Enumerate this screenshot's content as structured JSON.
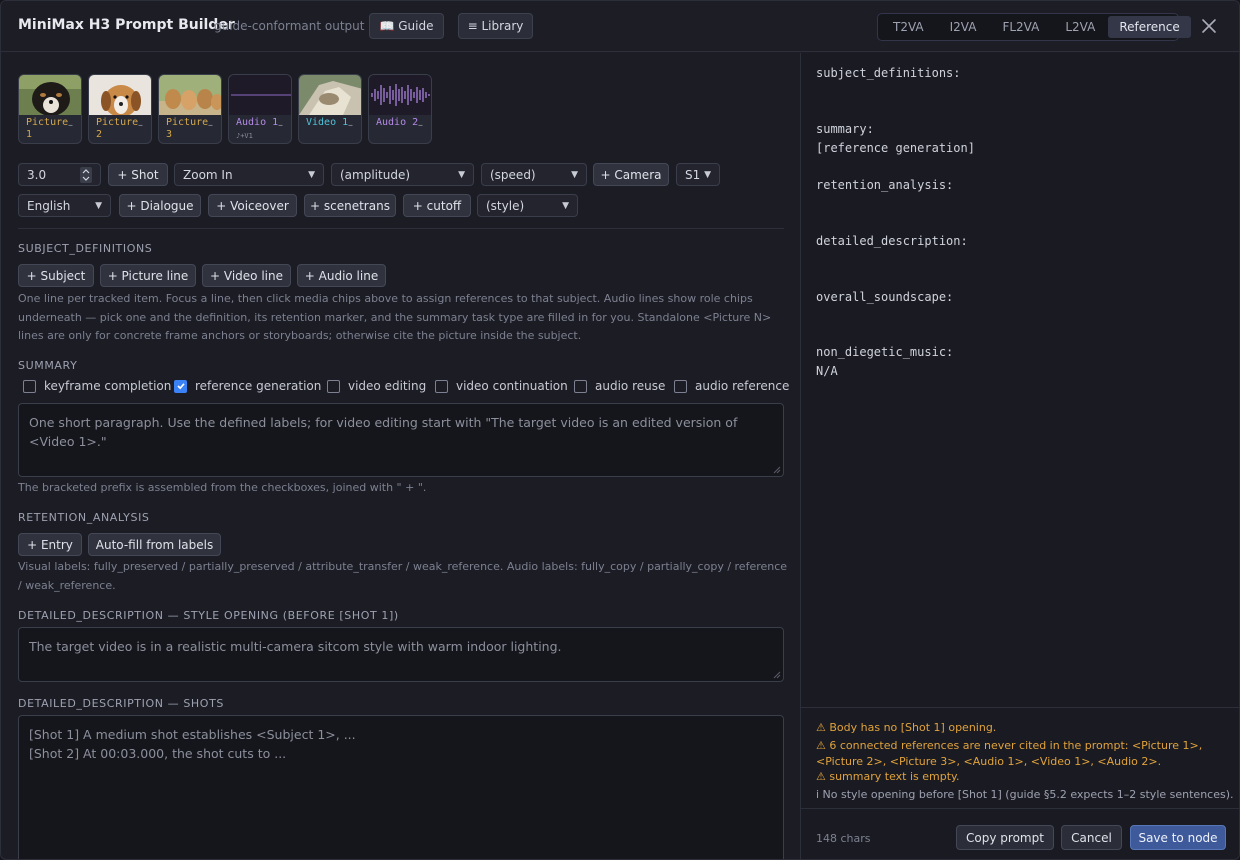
{
  "header": {
    "title": "MiniMax H3 Prompt Builder",
    "subtitle": "guide-conformant output",
    "guide_label": "📖 Guide",
    "library_label": "≡ Library",
    "tabs": [
      "T2VA",
      "I2VA",
      "FL2VA",
      "L2VA",
      "Reference"
    ],
    "active_tab": "Reference"
  },
  "media": [
    {
      "label": "Picture 1",
      "remove": "–",
      "kind": "picture"
    },
    {
      "label": "Picture 2",
      "remove": "–",
      "kind": "picture"
    },
    {
      "label": "Picture 3",
      "remove": "–",
      "kind": "picture"
    },
    {
      "label": "Audio 1",
      "remove": "–",
      "kind": "audio",
      "sub": "♪+V1"
    },
    {
      "label": "Video 1",
      "remove": "–",
      "kind": "video"
    },
    {
      "label": "Audio 2",
      "remove": "–",
      "kind": "audio"
    }
  ],
  "controls": {
    "duration": "3.0",
    "shot_btn": "+ Shot",
    "camera_move": "Zoom In",
    "amplitude": "(amplitude)",
    "speed": "(speed)",
    "camera_btn": "+ Camera",
    "speaker": "S1",
    "language": "English",
    "dialogue_btn": "+ Dialogue",
    "voiceover_btn": "+ Voiceover",
    "scenetrans_btn": "+ scenetrans",
    "cutoff_btn": "+ cutoff",
    "style": "(style)"
  },
  "subject_definitions": {
    "heading": "SUBJECT_DEFINITIONS",
    "buttons": [
      "+ Subject",
      "+ Picture line",
      "+ Video line",
      "+ Audio line"
    ],
    "help": "One line per tracked item. Focus a line, then click media chips above to assign references to that subject. Audio lines show role chips underneath — pick one and the definition, its retention marker, and the summary task type are filled in for you. Standalone <Picture N> lines are only for concrete frame anchors or storyboards; otherwise cite the picture inside the subject."
  },
  "summary": {
    "heading": "SUMMARY",
    "checkboxes": [
      {
        "label": "keyframe completion",
        "checked": false
      },
      {
        "label": "reference generation",
        "checked": true
      },
      {
        "label": "video editing",
        "checked": false
      },
      {
        "label": "video continuation",
        "checked": false
      },
      {
        "label": "audio reuse",
        "checked": false
      },
      {
        "label": "audio reference",
        "checked": false
      }
    ],
    "placeholder": "One short paragraph. Use the defined labels; for video editing start with \"The target video is an edited version of <Video 1>.\"",
    "help": "The bracketed prefix is assembled from the checkboxes, joined with \" + \"."
  },
  "retention": {
    "heading": "RETENTION_ANALYSIS",
    "entry_btn": "+ Entry",
    "autofill_btn": "Auto-fill from labels",
    "help": "Visual labels: fully_preserved / partially_preserved / attribute_transfer / weak_reference. Audio labels: fully_copy / partially_copy / reference / weak_reference."
  },
  "style_opening": {
    "heading": "DETAILED_DESCRIPTION — STYLE OPENING (BEFORE [SHOT 1])",
    "placeholder": "The target video is in a realistic multi-camera sitcom style with warm indoor lighting."
  },
  "shots": {
    "heading": "DETAILED_DESCRIPTION — SHOTS",
    "line1": "[Shot 1] A medium shot establishes <Subject 1>, ...",
    "line2": "[Shot 2] At 00:03.000, the shot cuts to ..."
  },
  "preview": {
    "subject_definitions": "subject_definitions:",
    "summary": "summary:",
    "summary_value": "[reference generation]",
    "retention_analysis": "retention_analysis:",
    "detailed_description": "detailed_description:",
    "overall_soundscape": "overall_soundscape:",
    "non_diegetic_music": "non_diegetic_music:",
    "non_diegetic_value": "N/A"
  },
  "warnings": {
    "w1": "⚠ Body has no [Shot 1] opening.",
    "w2": "⚠ 6 connected references are never cited in the prompt: <Picture 1>, <Picture 2>, <Picture 3>, <Audio 1>, <Video 1>, <Audio 2>.",
    "w3": "⚠ summary text is empty.",
    "info": "i No style opening before [Shot 1] (guide §5.2 expects 1–2 style sentences)."
  },
  "footer": {
    "chars": "148 chars",
    "copy": "Copy prompt",
    "cancel": "Cancel",
    "save": "Save to node"
  },
  "colors": {
    "picture_label": "#d6a94a",
    "audio_label": "#b58ae8",
    "video_label": "#4fc3d9",
    "warning": "#e0a23c",
    "primary": "#3e5a9a"
  }
}
